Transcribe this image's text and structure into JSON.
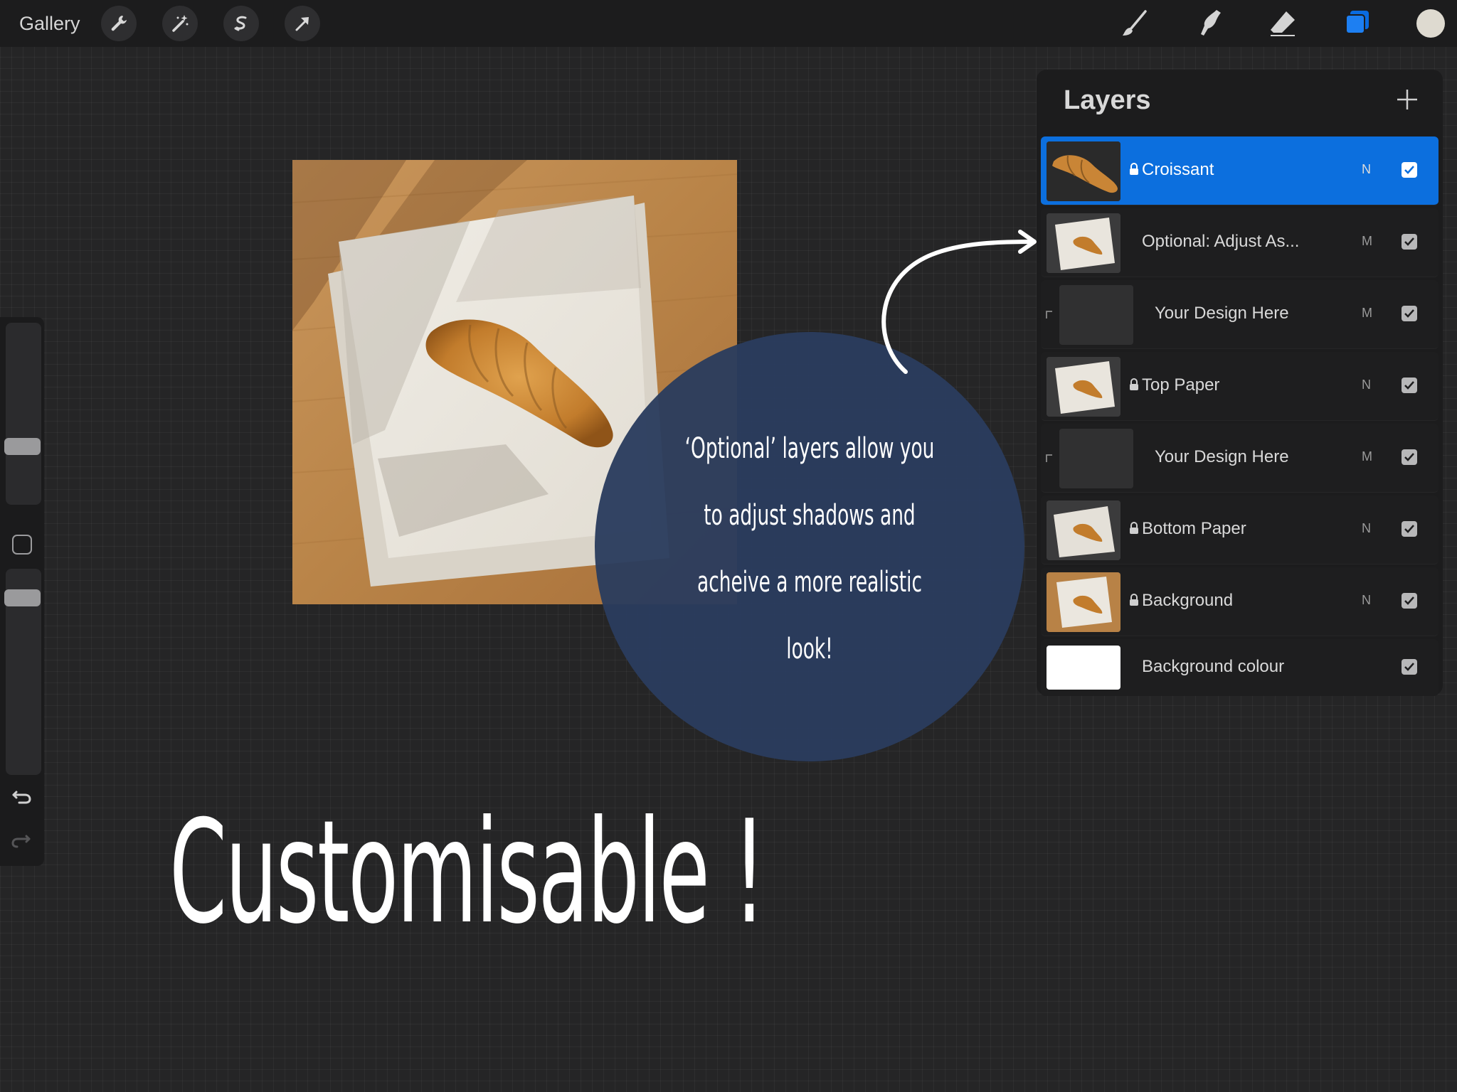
{
  "topbar": {
    "gallery_label": "Gallery",
    "left_tools": [
      "wrench-icon",
      "magic-wand-icon",
      "selection-icon",
      "transform-arrow-icon"
    ],
    "right_tools": [
      "brush-icon",
      "smudge-icon",
      "eraser-icon",
      "layers-icon"
    ],
    "active_tool_color": "#0c6fde"
  },
  "canvas": {
    "callout_text": "‘Optional’ layers allow you to adjust shadows and acheive a more realistic look!",
    "headline": "Customisable !",
    "callout_color": "#2b3c5e"
  },
  "layers": {
    "title": "Layers",
    "items": [
      {
        "name": "Croissant",
        "blend": "N",
        "locked": true,
        "visible": true,
        "selected": true,
        "thumb": "croissant"
      },
      {
        "name": "Optional: Adjust As...",
        "blend": "M",
        "locked": false,
        "visible": true,
        "selected": false,
        "thumb": "paper"
      },
      {
        "name": "Your Design Here",
        "blend": "M",
        "locked": false,
        "visible": true,
        "selected": false,
        "thumb": "empty",
        "clipped": true
      },
      {
        "name": "Top Paper",
        "blend": "N",
        "locked": true,
        "visible": true,
        "selected": false,
        "thumb": "paper"
      },
      {
        "name": "Your Design Here",
        "blend": "M",
        "locked": false,
        "visible": true,
        "selected": false,
        "thumb": "empty",
        "clipped": true
      },
      {
        "name": "Bottom Paper",
        "blend": "N",
        "locked": true,
        "visible": true,
        "selected": false,
        "thumb": "paper"
      },
      {
        "name": "Background",
        "blend": "N",
        "locked": true,
        "visible": true,
        "selected": false,
        "thumb": "wood"
      },
      {
        "name": "Background colour",
        "blend": "",
        "locked": false,
        "visible": true,
        "selected": false,
        "thumb": "white"
      }
    ]
  }
}
